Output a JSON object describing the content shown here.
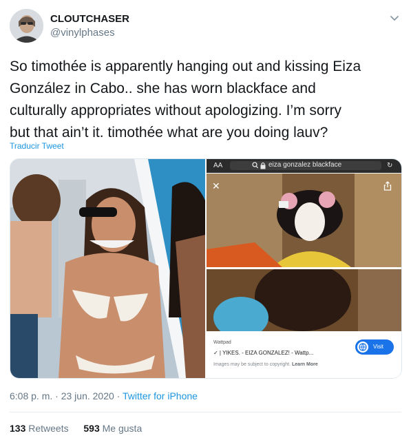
{
  "user": {
    "display_name": "CLOUTCHASER",
    "handle": "@vinylphases",
    "avatar_icon": "profile-photo"
  },
  "tweet": {
    "text": "So timothée is apparently hanging out and kissing Eiza\nGonzález in Cabo.. she has worn blackface and\nculturally appropriates without apologizing. I’m sorry\nbut that ain’t it. timothée what are you doing lauv?",
    "translate_label": "Traducir Tweet"
  },
  "media": {
    "browser": {
      "aa_label": "AA",
      "url_text": "eiza gonzalez blackface"
    },
    "card": {
      "source": "Wattpad",
      "title": "✓ | YIKES. - EIZA GONZALEZ! - Wattp...",
      "copyright": "Images may be subject to copyright.",
      "learn_more": "Learn More",
      "visit_label": "Visit"
    }
  },
  "meta": {
    "time": "6:08 p. m.",
    "separator": " · ",
    "date": "23 jun. 2020",
    "source": "Twitter for iPhone"
  },
  "stats": {
    "retweets_count": "133",
    "retweets_label": "Retweets",
    "likes_count": "593",
    "likes_label": "Me gusta"
  },
  "colors": {
    "link": "#1b95e0",
    "secondary_text": "#657786",
    "primary_text": "#14171a"
  }
}
